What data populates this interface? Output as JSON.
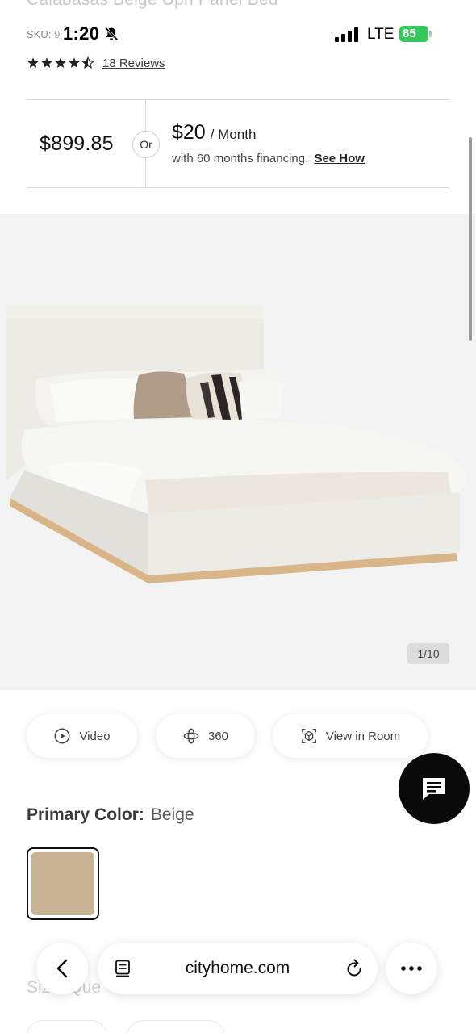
{
  "page": {
    "title_faded": "Calabasas Beige Uph Panel Bed"
  },
  "status_bar": {
    "time": "1:20",
    "carrier": "LTE",
    "battery": "85",
    "sku_label": "SKU:",
    "sku_value": "9"
  },
  "product": {
    "rating_value": 4.5,
    "reviews_label": "18 Reviews",
    "price": "$899.85",
    "or_label": "Or",
    "monthly_amount": "$20",
    "monthly_unit": "/ Month",
    "financing_text": "with 60 months financing.",
    "see_how_label": "See How",
    "image_counter": "1/10"
  },
  "media_buttons": {
    "video": "Video",
    "spin": "360",
    "room": "View in Room"
  },
  "color": {
    "label": "Primary Color:",
    "value": "Beige",
    "swatch_hex": "#c8b394"
  },
  "size": {
    "label": "Size: Que"
  },
  "browser": {
    "url": "cityhome.com"
  },
  "colors": {
    "battery": "#34c759",
    "fab": "#0a0a0a",
    "accent_text": "#1f1f1f"
  }
}
